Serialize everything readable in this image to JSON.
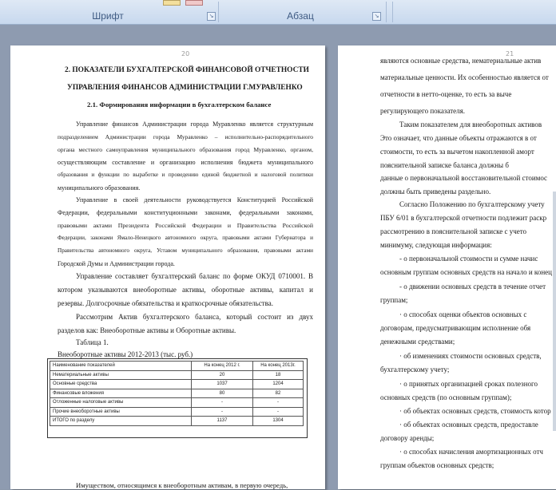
{
  "ribbon": {
    "font_group": "Шрифт",
    "paragraph_group": "Абзац",
    "launcher_glyph": "↘"
  },
  "left_page": {
    "page_number": "20",
    "heading1_line1": "2. ПОКАЗАТЕЛИ БУХГАЛТЕРСКОЙ ФИНАНСОВОЙ ОТЧЕТНОСТИ",
    "heading1_line2": "УПРАВЛЕНИЯ ФИНАНСОВ АДМИНИСТРАЦИИ Г.МУРАВЛЕНКО",
    "heading2": "2.1. Формирования информации в бухгалтерском балансе",
    "p1": [
      "Управление финансов Администрации города Муравленко является структурным",
      "подразделением Администрации города Муравленко – исполнительно-распорядительного",
      "органа местного самоуправления муниципального образования город Муравленко, органом,",
      "осуществляющим составление и организацию исполнения бюджета муниципального",
      "образования и функции по выработке и проведению единой бюджетной и налоговой политики",
      "муниципального образования."
    ],
    "p2": [
      "Управление в своей деятельности руководствуется Конституцией Российской",
      "Федерации, федеральными конституционными законами, федеральными законами,",
      "правовыми актами Президента Российской Федерации и Правительства Российской",
      "Федерации, законами Ямало-Ненецкого автономного округа, правовыми актами Губернатора и",
      "Правительства автономного округа, Уставом муниципального образования, правовыми актами",
      "Городской Думы и Администрации города."
    ],
    "p3": [
      "Управление составляет бухгалтерский баланс по форме ОКУД 0710001. В",
      "котором указываются внеоборотные активы, оборотные активы, капитал и",
      "резервы. Долгосрочные обязательства и краткосрочные обязательства."
    ],
    "p4": [
      "Рассмотрим Актив бухгалтерского баланса, который состоит из двух",
      "разделов как: Внеоборотные активы и Оборотные активы."
    ],
    "table_caption": "Таблица 1.",
    "table_title": "Внеоборотные активы 2012-2013 (тыс. руб.)",
    "table": {
      "headers": [
        "Наименование показателей",
        "На конец 2012 г.",
        "На конец 2013г."
      ],
      "rows": [
        [
          "Нематериальные активы",
          "20",
          "18"
        ],
        [
          "Основные средства",
          "1037",
          "1204"
        ],
        [
          "Финансовые вложения",
          "80",
          "82"
        ],
        [
          "Отложенные налоговые активы",
          "-",
          "-"
        ],
        [
          "Прочие внеоборотные активы",
          "-",
          "-"
        ],
        [
          "ИТОГО по разделу",
          "1137",
          "1304"
        ]
      ]
    },
    "last_line": "Имуществом, относящимся к внеоборотным активам, в первую очередь,"
  },
  "right_page": {
    "page_number": "21",
    "lines": [
      "являются основные средства, нематериальные актив",
      "материальные ценности. Их особенностью является от",
      "отчетности в нетто-оценке, то есть за выче",
      "регулирующего показателя.",
      "Таким показателем для внеоборотных активов",
      "Это означает, что данные объекты отражаются в от",
      "стоимости, то есть за вычетом накопленной аморт",
      "пояснительной записке баланса должны б",
      "данные о первоначальной восстановительной стоимос",
      "должны быть приведены раздельно.",
      "Согласно Положению по бухгалтерскому учету",
      "ПБУ 6/01 в бухгалтерской отчетности подлежит раскр",
      "рассмотрению в пояснительной записке с учето",
      "минимуму, следующая информация:",
      "- о первоначальной стоимости и сумме начис",
      "основным группам основных средств на начало и конец",
      "- о движении основных средств в течение отчет",
      "группам;",
      "· о способах оценки объектов основных с",
      "договорам, предусматривающим исполнение обя",
      "денежными средствами;",
      "· об изменениях стоимости основных средств,",
      "бухгалтерскому учету;",
      "· о принятых организацией сроках полезного",
      "основных средств (по основным группам);",
      "· об объектах основных средств, стоимость котор",
      "· об объектах основных средств, предоставле",
      "договору аренды;",
      "· о способах начисления амортизационных отч",
      "группам объектов основных средств;"
    ]
  }
}
